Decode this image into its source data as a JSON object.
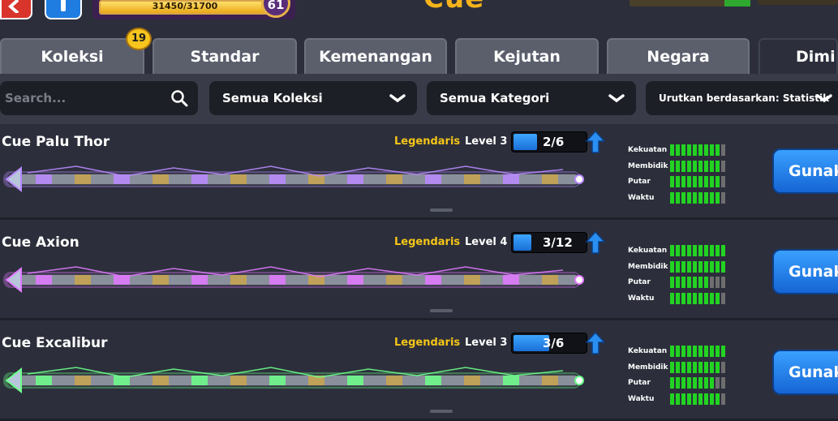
{
  "header": {
    "title": "Cue",
    "xp_text": "31450/31700",
    "xp_progress": 0.992,
    "player_level": "61"
  },
  "tabs": [
    {
      "label": "Koleksi",
      "badge": "19"
    },
    {
      "label": "Standar"
    },
    {
      "label": "Kemenangan"
    },
    {
      "label": "Kejutan"
    },
    {
      "label": "Negara"
    },
    {
      "label": "Dimi",
      "active": true
    }
  ],
  "filters": {
    "search_placeholder": "Search...",
    "collection": "Semua Koleksi",
    "category": "Semua Kategori",
    "sort": "Urutkan berdasarkan: Statistik"
  },
  "stat_labels": [
    "Kekuatan",
    "Membidik",
    "Putar",
    "Waktu"
  ],
  "cues": [
    {
      "name": "Cue Palu Thor",
      "rarity": "Legendaris",
      "level": "Level 3",
      "pieces": "2/6",
      "pieces_fraction": 0.33,
      "stats": [
        9,
        9,
        9,
        9
      ],
      "use_label": "Gunakan",
      "glow": "#b889ff"
    },
    {
      "name": "Cue Axion",
      "rarity": "Legendaris",
      "level": "Level 4",
      "pieces": "3/12",
      "pieces_fraction": 0.25,
      "stats": [
        10,
        10,
        7,
        9
      ],
      "use_label": "Gunakan",
      "glow": "#e079ff"
    },
    {
      "name": "Cue Excalibur",
      "rarity": "Legendaris",
      "level": "Level 3",
      "pieces": "3/6",
      "pieces_fraction": 0.5,
      "stats": [
        10,
        9,
        8,
        9
      ],
      "use_label": "Gunakan",
      "glow": "#6cff8a"
    }
  ],
  "stat_max": 10,
  "colors": {
    "stat_on": "#22d322",
    "stat_off": "#6e6e6e",
    "rarity": "#f5c518",
    "accent_blue": "#1f7ce0",
    "title": "#f5b31b"
  }
}
